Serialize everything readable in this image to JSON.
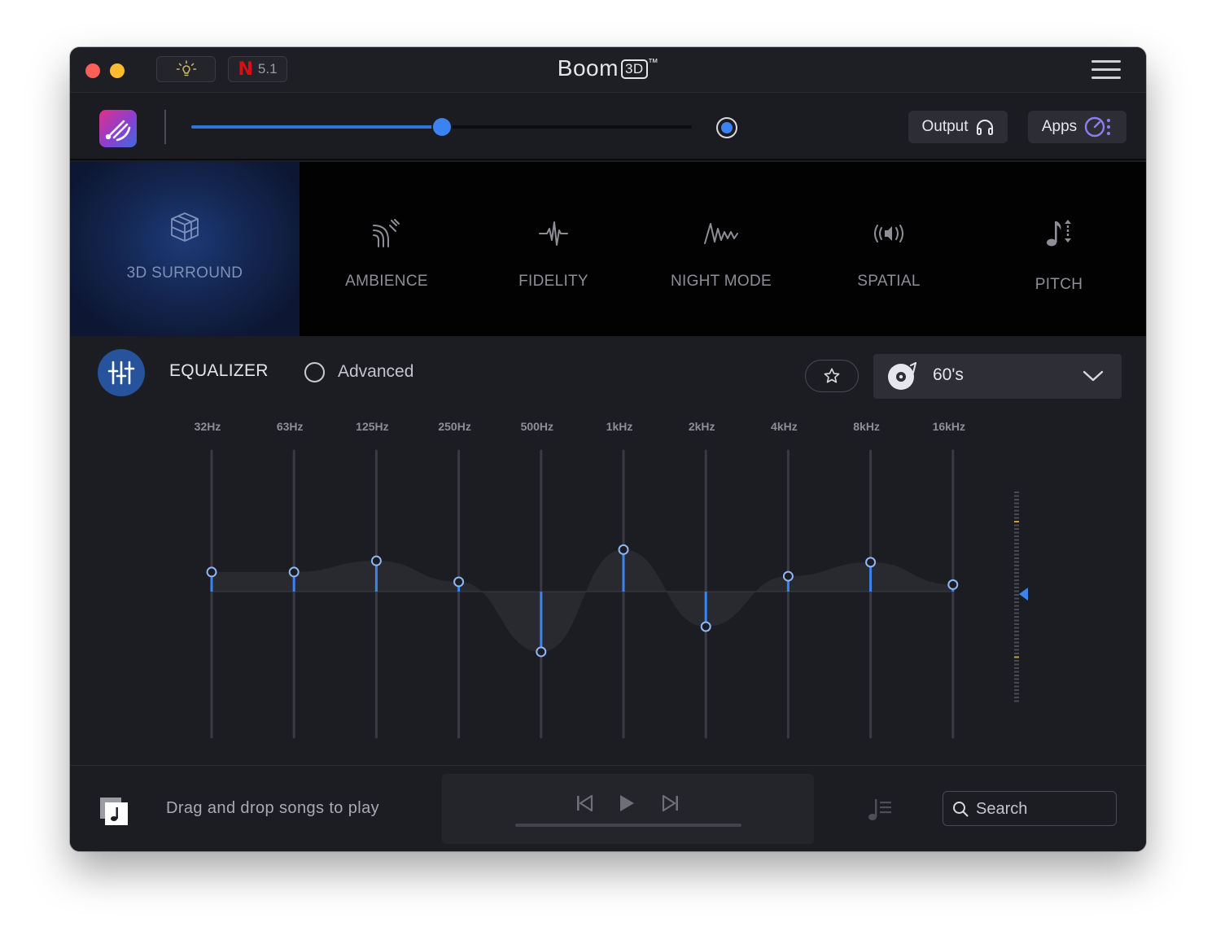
{
  "window": {
    "title": "Boom",
    "title_badge": "3D",
    "title_tm": "™"
  },
  "titlebar": {
    "netflix_label": "5.1",
    "icons": [
      "bulb-icon",
      "netflix-icon",
      "menu-icon"
    ]
  },
  "volume": {
    "level": 0.5,
    "output_label": "Output",
    "apps_label": "Apps"
  },
  "effects": [
    {
      "key": "3d-surround",
      "label": "3D SURROUND",
      "icon": "cube-icon",
      "active": true
    },
    {
      "key": "ambience",
      "label": "AMBIENCE",
      "icon": "ambience-icon",
      "active": false
    },
    {
      "key": "fidelity",
      "label": "FIDELITY",
      "icon": "fidelity-icon",
      "active": false
    },
    {
      "key": "night-mode",
      "label": "NIGHT MODE",
      "icon": "night-mode-icon",
      "active": false
    },
    {
      "key": "spatial",
      "label": "SPATIAL",
      "icon": "spatial-icon",
      "active": false
    },
    {
      "key": "pitch",
      "label": "PITCH",
      "icon": "pitch-icon",
      "active": false
    }
  ],
  "equalizer": {
    "title": "EQUALIZER",
    "advanced_label": "Advanced",
    "advanced_checked": false,
    "preset": "60's",
    "bands": [
      {
        "label": "32Hz",
        "gain": 0.14
      },
      {
        "label": "63Hz",
        "gain": 0.14
      },
      {
        "label": "125Hz",
        "gain": 0.22
      },
      {
        "label": "250Hz",
        "gain": 0.07
      },
      {
        "label": "500Hz",
        "gain": -0.43
      },
      {
        "label": "1kHz",
        "gain": 0.3
      },
      {
        "label": "2kHz",
        "gain": -0.25
      },
      {
        "label": "4kHz",
        "gain": 0.11
      },
      {
        "label": "8kHz",
        "gain": 0.21
      },
      {
        "label": "16kHz",
        "gain": 0.05
      }
    ],
    "preamp": 0.0
  },
  "bottom": {
    "drag_text": "Drag and drop songs to play",
    "search_placeholder": "Search"
  },
  "colors": {
    "accent": "#3b82f2",
    "background": "#1c1d22",
    "effects_bg": "#020203",
    "active_effect": "#13254e"
  }
}
